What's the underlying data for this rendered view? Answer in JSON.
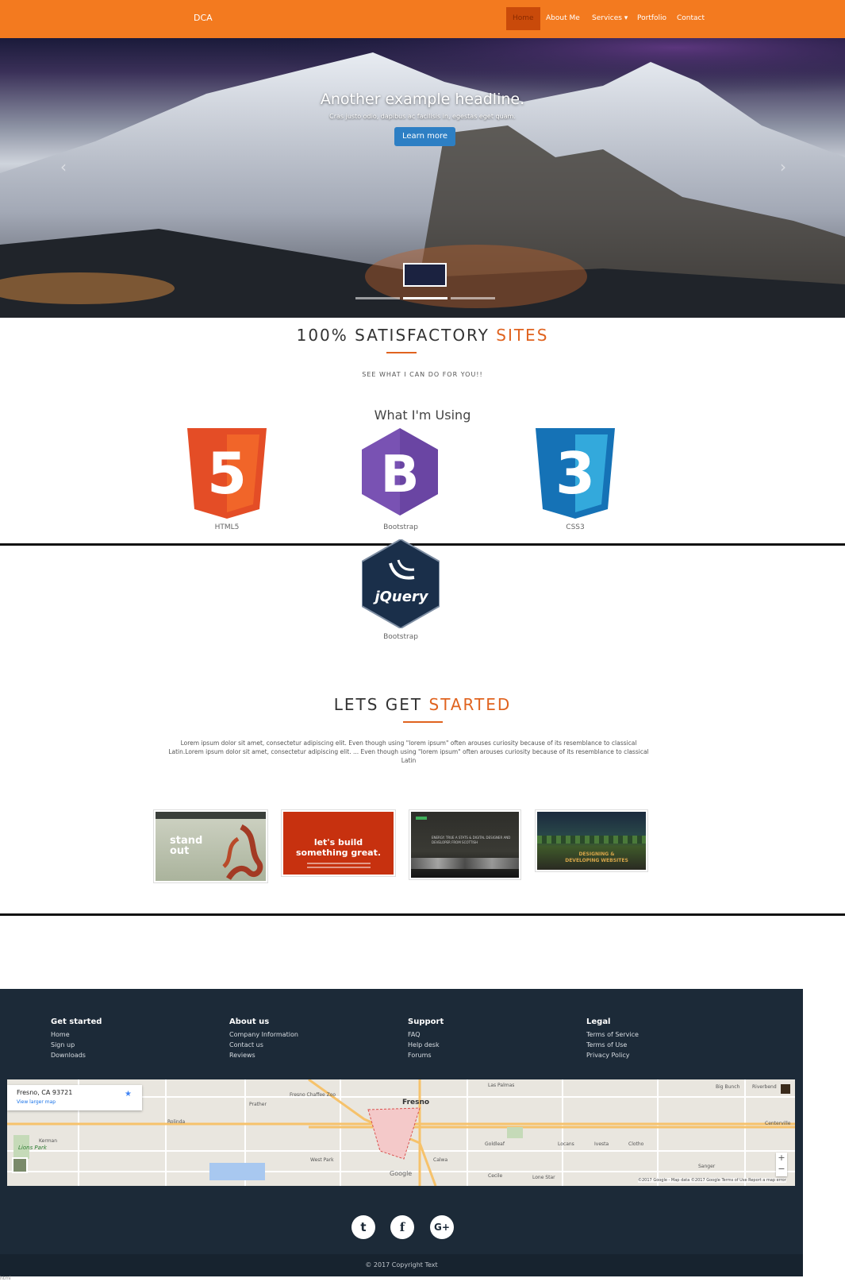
{
  "nav": {
    "brand": "DCA",
    "items": [
      {
        "label": "Home",
        "active": true
      },
      {
        "label": "About Me"
      },
      {
        "label": "Services ▾"
      },
      {
        "label": "Portfolio"
      },
      {
        "label": "Contact"
      }
    ]
  },
  "hero": {
    "headline": "Another example headline.",
    "caption": "Cras justo odio, dapibus ac facilisis in, egestas eget quam.",
    "button": "Learn more",
    "prev_icon": "chevron-left-icon",
    "next_icon": "chevron-right-icon"
  },
  "satisfactory": {
    "title_main": "100% SATISFACTORY",
    "title_accent": "SITES",
    "subtitle": "SEE WHAT I CAN DO FOR YOU!!"
  },
  "using": {
    "heading": "What I'm Using",
    "items": [
      {
        "label": "HTML5",
        "icon": "html5-icon"
      },
      {
        "label": "Bootstrap",
        "icon": "bootstrap-icon"
      },
      {
        "label": "CSS3",
        "icon": "css3-icon"
      },
      {
        "label": "Bootstrap",
        "icon": "jquery-icon"
      }
    ],
    "html5_glyph": "5",
    "bootstrap_glyph": "B",
    "css3_glyph": "3",
    "jquery_glyph": "jQuery"
  },
  "started": {
    "title_main": "LETS GET",
    "title_accent": "STARTED",
    "paragraph": "Lorem ipsum dolor sit amet, consectetur adipiscing elit. Even though using \"lorem ipsum\" often arouses curiosity because of its resemblance to classical Latin.Lorem ipsum dolor sit amet, consectetur adipiscing elit. ... Even though using \"lorem ipsum\" often arouses curiosity because of its resemblance to classical Latin"
  },
  "portfolio": [
    {
      "text": "stand out"
    },
    {
      "text": "let's build something great."
    },
    {
      "text": "ENERGY. TRUE A STATS & DIGITAL DESIGNER AND DEVELOPER FROM SCOTTISH"
    },
    {
      "text": "DESIGNING & DEVELOPING WEBSITES"
    }
  ],
  "footer": {
    "columns": [
      {
        "heading": "Get started",
        "links": [
          "Home",
          "Sign up",
          "Downloads"
        ]
      },
      {
        "heading": "About us",
        "links": [
          "Company Information",
          "Contact us",
          "Reviews"
        ]
      },
      {
        "heading": "Support",
        "links": [
          "FAQ",
          "Help desk",
          "Forums"
        ]
      },
      {
        "heading": "Legal",
        "links": [
          "Terms of Service",
          "Terms of Use",
          "Privacy Policy"
        ]
      }
    ],
    "map": {
      "address": "Fresno, CA 93721",
      "larger_link": "View larger map",
      "city": "Fresno",
      "places": [
        "Fresno Chaffee Zoo",
        "Las Palmas",
        "Big Bunch",
        "Riverbend",
        "Prather",
        "Rolinda",
        "Kerman",
        "Lions Park",
        "West Park",
        "Calwa",
        "Goldleaf",
        "Locans",
        "Ivesta",
        "Clotho",
        "Sanger",
        "Centerville",
        "Cecile",
        "Lone Star"
      ],
      "credit": "©2017 Google - Map data ©2017 Google   Terms of Use   Report a map error",
      "google": "Google"
    },
    "social": [
      {
        "glyph": "t",
        "icon": "twitter-icon"
      },
      {
        "glyph": "f",
        "icon": "facebook-icon"
      },
      {
        "glyph": "G+",
        "icon": "google-plus-icon"
      }
    ],
    "copyright": "© 2017 Copyright Text"
  },
  "status_text": "html"
}
